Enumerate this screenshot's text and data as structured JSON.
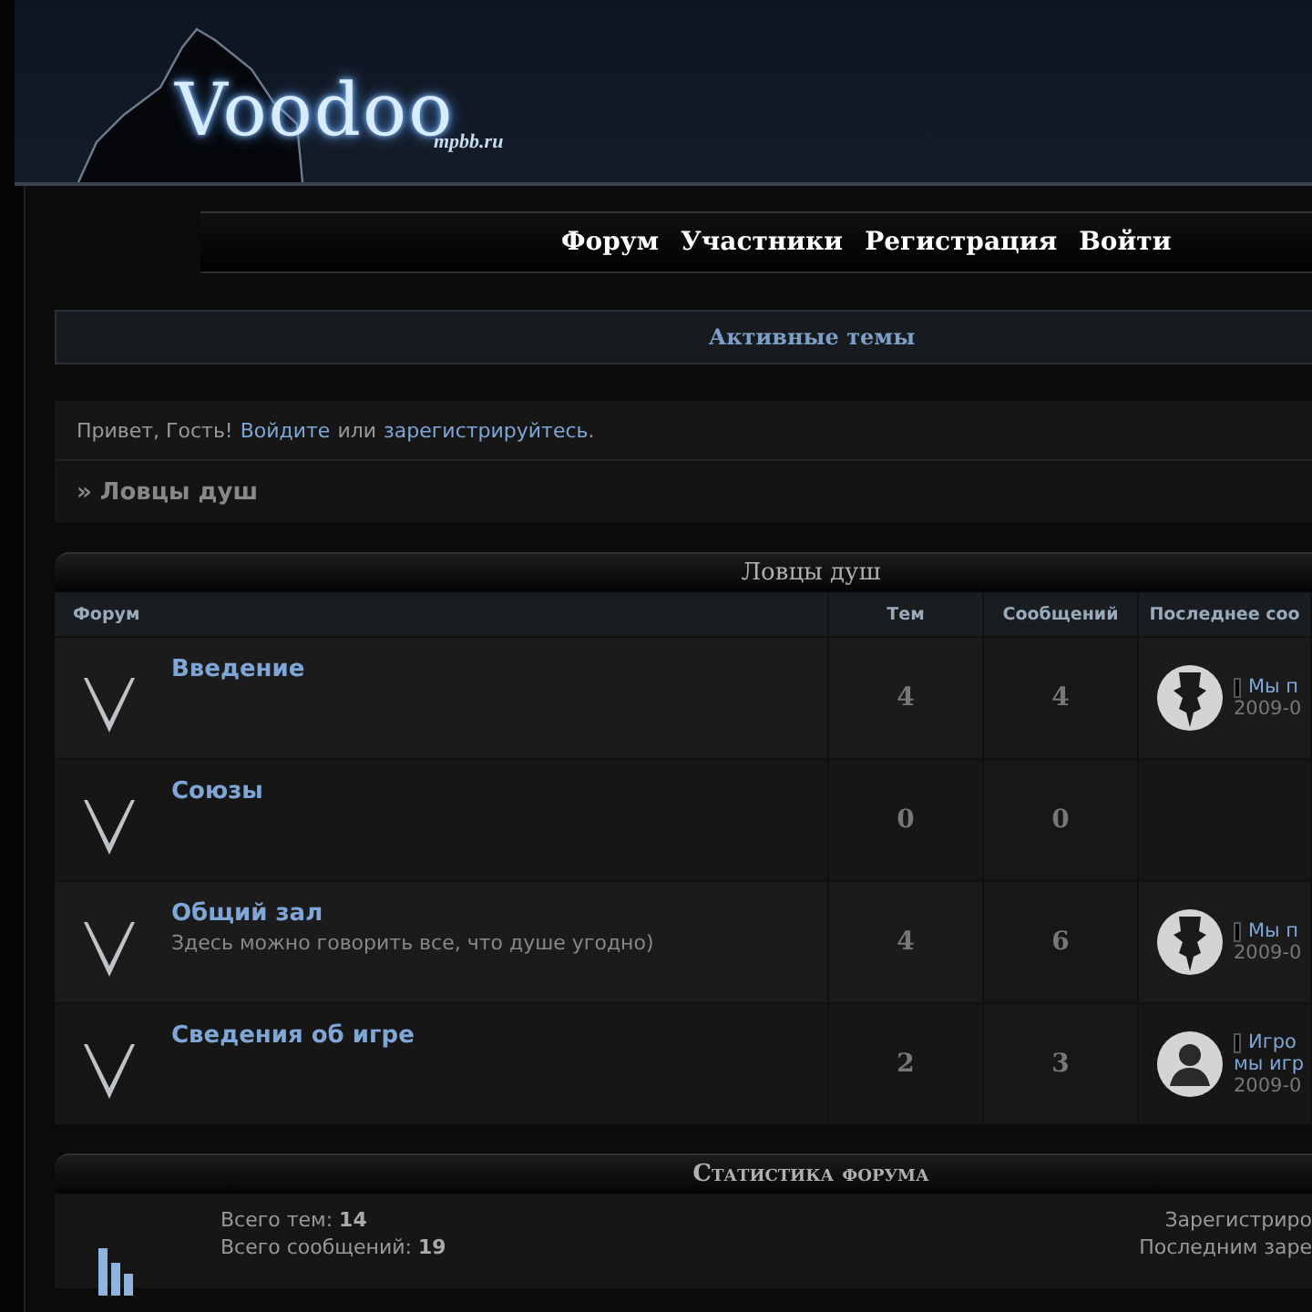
{
  "logo": {
    "title": "Voodoo",
    "subtitle": "mpbb.ru"
  },
  "nav": [
    "Форум",
    "Участники",
    "Регистрация",
    "Войти"
  ],
  "active_topics": "Активные темы",
  "welcome": {
    "text": "Привет, Гость!",
    "login": "Войдите",
    "or": "или",
    "register": "зарегистрируйтесь",
    "end": "."
  },
  "breadcrumb": "» Ловцы душ",
  "category": {
    "title": "Ловцы душ",
    "columns": [
      "Форум",
      "Тем",
      "Сообщений",
      "Последнее соо"
    ],
    "rows": [
      {
        "name": "Введение",
        "topics": "4",
        "posts": "4",
        "last_post": {
          "kind": "emblem",
          "lines": [
            "Мы п"
          ],
          "date": "2009-0"
        }
      },
      {
        "name": "Союзы",
        "topics": "0",
        "posts": "0"
      },
      {
        "name": "Общий зал",
        "description": "Здесь можно говорить все, что душе угодно)",
        "topics": "4",
        "posts": "6",
        "last_post": {
          "kind": "emblem",
          "lines": [
            "Мы п"
          ],
          "date": "2009-0"
        }
      },
      {
        "name": "Сведения об игре",
        "topics": "2",
        "posts": "3",
        "last_post": {
          "kind": "silhouette",
          "lines": [
            "Игро",
            "мы игр"
          ],
          "date": "2009-0"
        }
      }
    ]
  },
  "stats": {
    "title": "Статистика форума",
    "left": [
      "Всего тем: **14**",
      "Всего сообщений: **19**"
    ],
    "right": [
      "Зарегистриро",
      "Последним заре"
    ]
  }
}
